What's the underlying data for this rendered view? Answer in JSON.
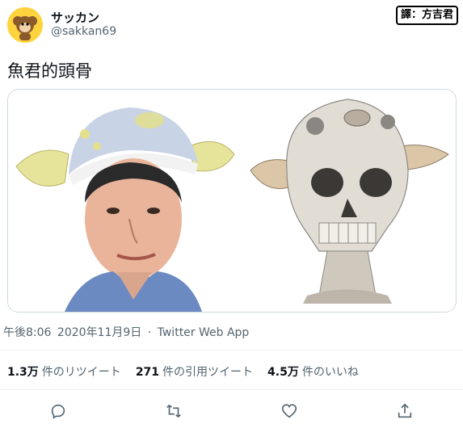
{
  "author": {
    "display_name": "サッカン",
    "handle": "@sakkan69"
  },
  "translator_tag": "譯：方吉君",
  "tweet": {
    "text": "魚君的頭骨"
  },
  "meta": {
    "time": "午後8:06",
    "date": "2020年11月9日",
    "separator": "·",
    "source": "Twitter Web App"
  },
  "stats": {
    "retweets_count": "1.3万",
    "retweets_label": "件のリツイート",
    "quotes_count": "271",
    "quotes_label": "件の引用ツイート",
    "likes_count": "4.5万",
    "likes_label": "件のいいね"
  },
  "actions": [
    "reply-icon",
    "retweet-icon",
    "like-icon",
    "share-icon"
  ],
  "colors": {
    "secondary_text": "#536471",
    "primary_text": "#0f1419",
    "border": "#cfd9de",
    "avatar_bg": "#ffd33d"
  }
}
